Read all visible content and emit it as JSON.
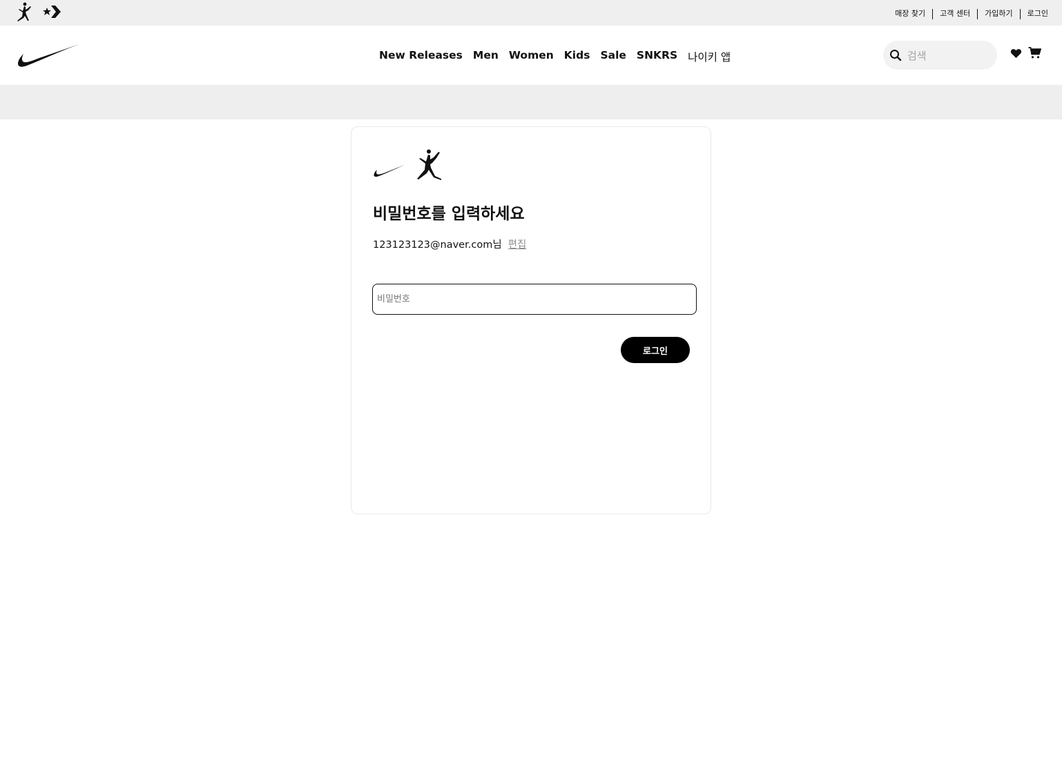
{
  "topbar": {
    "brands": [
      "jordan-jumpman-icon",
      "converse-star-chevron-icon"
    ],
    "links": [
      "매장 찾기",
      "고객 센터",
      "가입하기",
      "로그인"
    ]
  },
  "nav": {
    "logo": "nike-swoosh-icon",
    "items": [
      "New Releases",
      "Men",
      "Women",
      "Kids",
      "Sale",
      "SNKRS",
      "나이키 앱"
    ],
    "search_placeholder": "검색",
    "icons": [
      "heart-icon",
      "cart-icon"
    ]
  },
  "login": {
    "logos": [
      "nike-swoosh-icon",
      "jordan-jumpman-icon"
    ],
    "heading": "비밀번호를 입력하세요",
    "email": "123123123@naver.com님",
    "edit_label": "편집",
    "password_placeholder": "비밀번호",
    "password_value": "",
    "submit_label": "로그인"
  },
  "colors": {
    "topbar_bg": "#efefef",
    "banner_bg": "#eeeeee",
    "primary": "#000000",
    "muted_text": "#8d8d8d"
  }
}
